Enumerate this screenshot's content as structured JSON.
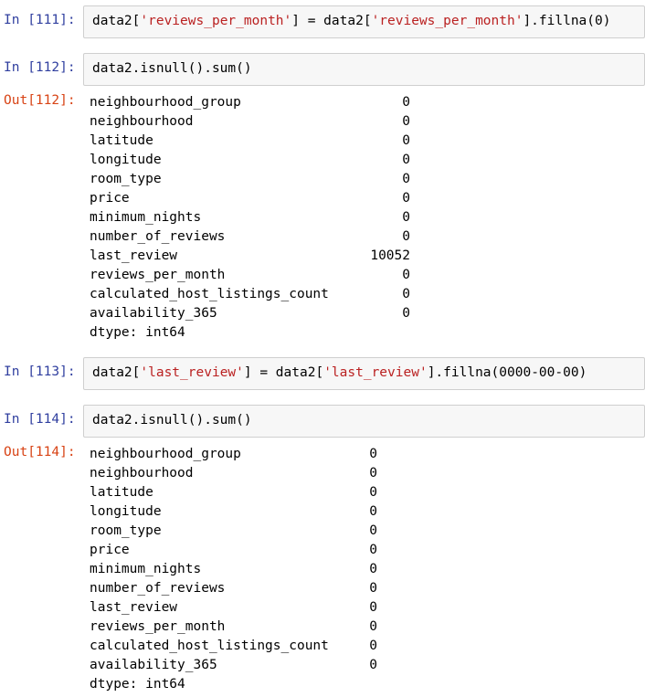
{
  "cells": [
    {
      "prompt": "In [111]:",
      "code_parts": [
        "data2[",
        "'reviews_per_month'",
        "] = data2[",
        "'reviews_per_month'",
        "].fillna(0)"
      ]
    },
    {
      "prompt": "In [112]:",
      "code_parts": [
        "data2.isnull().sum()"
      ]
    },
    {
      "prompt": "Out[112]:",
      "rows": [
        {
          "key": "neighbourhood_group",
          "value": "0"
        },
        {
          "key": "neighbourhood",
          "value": "0"
        },
        {
          "key": "latitude",
          "value": "0"
        },
        {
          "key": "longitude",
          "value": "0"
        },
        {
          "key": "room_type",
          "value": "0"
        },
        {
          "key": "price",
          "value": "0"
        },
        {
          "key": "minimum_nights",
          "value": "0"
        },
        {
          "key": "number_of_reviews",
          "value": "0"
        },
        {
          "key": "last_review",
          "value": "10052"
        },
        {
          "key": "reviews_per_month",
          "value": "0"
        },
        {
          "key": "calculated_host_listings_count",
          "value": "0"
        },
        {
          "key": "availability_365",
          "value": "0"
        }
      ],
      "dtype": "dtype: int64"
    },
    {
      "prompt": "In [113]:",
      "code_parts": [
        "data2[",
        "'last_review'",
        "] = data2[",
        "'last_review'",
        "].fillna(0000-00-00)"
      ]
    },
    {
      "prompt": "In [114]:",
      "code_parts": [
        "data2.isnull().sum()"
      ]
    },
    {
      "prompt": "Out[114]:",
      "rows": [
        {
          "key": "neighbourhood_group",
          "value": "0"
        },
        {
          "key": "neighbourhood",
          "value": "0"
        },
        {
          "key": "latitude",
          "value": "0"
        },
        {
          "key": "longitude",
          "value": "0"
        },
        {
          "key": "room_type",
          "value": "0"
        },
        {
          "key": "price",
          "value": "0"
        },
        {
          "key": "minimum_nights",
          "value": "0"
        },
        {
          "key": "number_of_reviews",
          "value": "0"
        },
        {
          "key": "last_review",
          "value": "0"
        },
        {
          "key": "reviews_per_month",
          "value": "0"
        },
        {
          "key": "calculated_host_listings_count",
          "value": "0"
        },
        {
          "key": "availability_365",
          "value": "0"
        }
      ],
      "dtype": "dtype: int64"
    }
  ],
  "colors": {
    "in_prompt": "#303f9f",
    "out_prompt": "#d84315",
    "string": "#ba2121"
  }
}
